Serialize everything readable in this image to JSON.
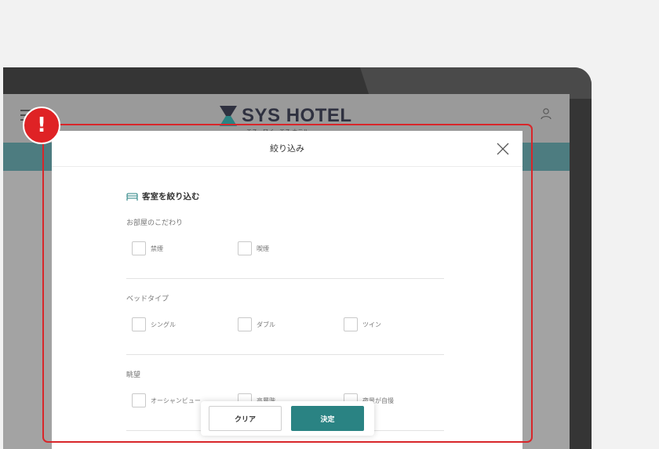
{
  "site": {
    "logo_text": "SYS HOTEL",
    "logo_subtext": "エス・ワイ・エス ホテル"
  },
  "modal": {
    "title": "絞り込み",
    "section_heading": "客室を絞り込む",
    "groups": [
      {
        "label": "お部屋のこだわり",
        "options": [
          "禁煙",
          "喫煙"
        ]
      },
      {
        "label": "ベッドタイプ",
        "options": [
          "シングル",
          "ダブル",
          "ツイン"
        ]
      },
      {
        "label": "眺望",
        "options": [
          "オーシャンビュー",
          "高層階",
          "夜景が自慢"
        ]
      }
    ]
  },
  "actions": {
    "clear_label": "クリア",
    "apply_label": "決定"
  },
  "alert": {
    "badge_symbol": "!"
  },
  "colors": {
    "accent_teal": "#2a8383",
    "highlight_red": "#d8262a"
  }
}
